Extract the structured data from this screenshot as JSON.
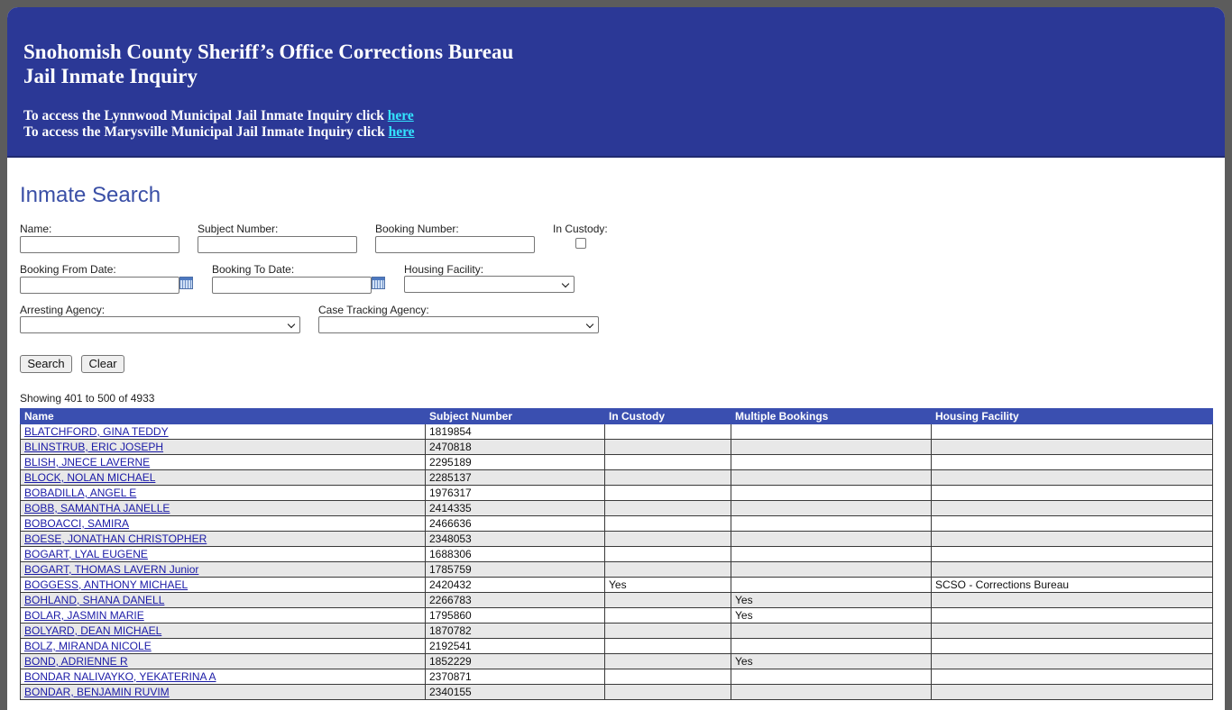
{
  "banner": {
    "title_line1": "Snohomish County Sheriff’s Office Corrections Bureau",
    "title_line2": "Jail Inmate Inquiry",
    "lynnwood_text": "To access the Lynnwood Municipal Jail Inmate Inquiry click",
    "marysville_text": "To access the Marysville Municipal Jail Inmate Inquiry click",
    "here_label": "here"
  },
  "search": {
    "heading": "Inmate Search",
    "name_label": "Name:",
    "subject_label": "Subject Number:",
    "booking_label": "Booking Number:",
    "custody_label": "In Custody:",
    "from_date_label": "Booking From Date:",
    "to_date_label": "Booking To Date:",
    "housing_label": "Housing Facility:",
    "arresting_label": "Arresting Agency:",
    "case_tracking_label": "Case Tracking Agency:",
    "search_button": "Search",
    "clear_button": "Clear",
    "showing_text": "Showing 401 to 500 of 4933"
  },
  "table": {
    "headers": [
      "Name",
      "Subject Number",
      "In Custody",
      "Multiple Bookings",
      "Housing Facility"
    ],
    "rows": [
      {
        "name": "BLATCHFORD, GINA TEDDY",
        "subject": "1819854",
        "custody": "",
        "multiple": "",
        "housing": ""
      },
      {
        "name": "BLINSTRUB, ERIC JOSEPH",
        "subject": "2470818",
        "custody": "",
        "multiple": "",
        "housing": ""
      },
      {
        "name": "BLISH, JNECE LAVERNE",
        "subject": "2295189",
        "custody": "",
        "multiple": "",
        "housing": ""
      },
      {
        "name": "BLOCK, NOLAN MICHAEL",
        "subject": "2285137",
        "custody": "",
        "multiple": "",
        "housing": ""
      },
      {
        "name": "BOBADILLA, ANGEL E",
        "subject": "1976317",
        "custody": "",
        "multiple": "",
        "housing": ""
      },
      {
        "name": "BOBB, SAMANTHA JANELLE",
        "subject": "2414335",
        "custody": "",
        "multiple": "",
        "housing": ""
      },
      {
        "name": "BOBOACCI, SAMIRA",
        "subject": "2466636",
        "custody": "",
        "multiple": "",
        "housing": ""
      },
      {
        "name": "BOESE, JONATHAN CHRISTOPHER",
        "subject": "2348053",
        "custody": "",
        "multiple": "",
        "housing": ""
      },
      {
        "name": "BOGART, LYAL EUGENE",
        "subject": "1688306",
        "custody": "",
        "multiple": "",
        "housing": ""
      },
      {
        "name": "BOGART, THOMAS LAVERN Junior",
        "subject": "1785759",
        "custody": "",
        "multiple": "",
        "housing": ""
      },
      {
        "name": "BOGGESS, ANTHONY MICHAEL",
        "subject": "2420432",
        "custody": "Yes",
        "multiple": "",
        "housing": "SCSO - Corrections Bureau"
      },
      {
        "name": "BOHLAND, SHANA DANELL",
        "subject": "2266783",
        "custody": "",
        "multiple": "Yes",
        "housing": ""
      },
      {
        "name": "BOLAR, JASMIN MARIE",
        "subject": "1795860",
        "custody": "",
        "multiple": "Yes",
        "housing": ""
      },
      {
        "name": "BOLYARD, DEAN MICHAEL",
        "subject": "1870782",
        "custody": "",
        "multiple": "",
        "housing": ""
      },
      {
        "name": "BOLZ, MIRANDA NICOLE",
        "subject": "2192541",
        "custody": "",
        "multiple": "",
        "housing": ""
      },
      {
        "name": "BOND, ADRIENNE R",
        "subject": "1852229",
        "custody": "",
        "multiple": "Yes",
        "housing": ""
      },
      {
        "name": "BONDAR NALIVAYKO, YEKATERINA A",
        "subject": "2370871",
        "custody": "",
        "multiple": "",
        "housing": ""
      },
      {
        "name": "BONDAR, BENJAMIN RUVIM",
        "subject": "2340155",
        "custody": "",
        "multiple": "",
        "housing": ""
      }
    ]
  }
}
